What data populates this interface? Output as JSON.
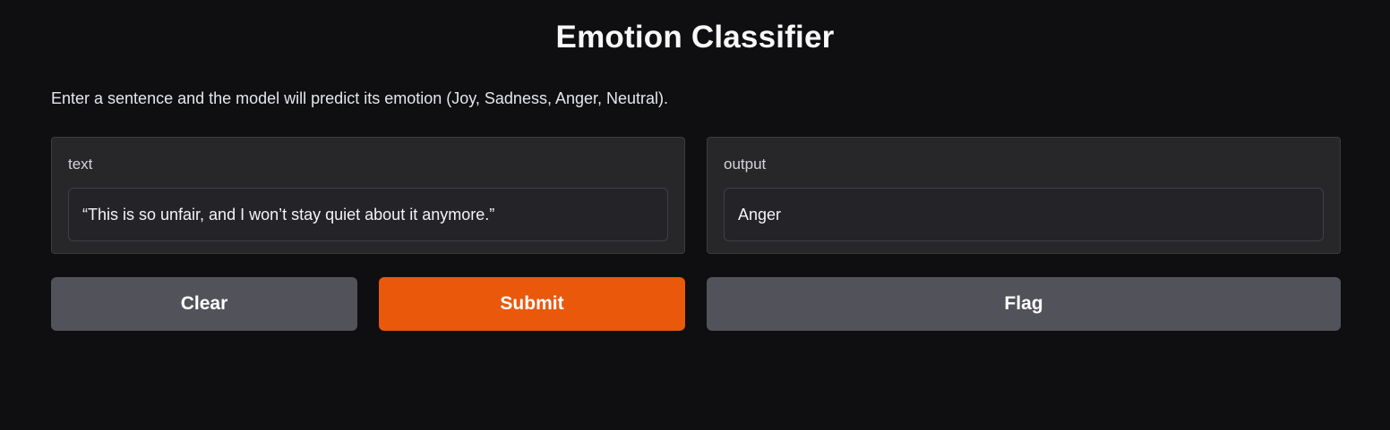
{
  "app": {
    "title": "Emotion Classifier",
    "description": "Enter a sentence and the model will predict its emotion (Joy, Sadness, Anger, Neutral)."
  },
  "input_panel": {
    "label": "text",
    "value": "“This is so unfair, and I won’t stay quiet about it anymore.”"
  },
  "output_panel": {
    "label": "output",
    "value": "Anger"
  },
  "buttons": {
    "clear": "Clear",
    "submit": "Submit",
    "flag": "Flag"
  },
  "colors": {
    "background": "#0f0f11",
    "panel": "#27272a",
    "primary_button": "#ea580c",
    "secondary_button": "#52525b"
  }
}
